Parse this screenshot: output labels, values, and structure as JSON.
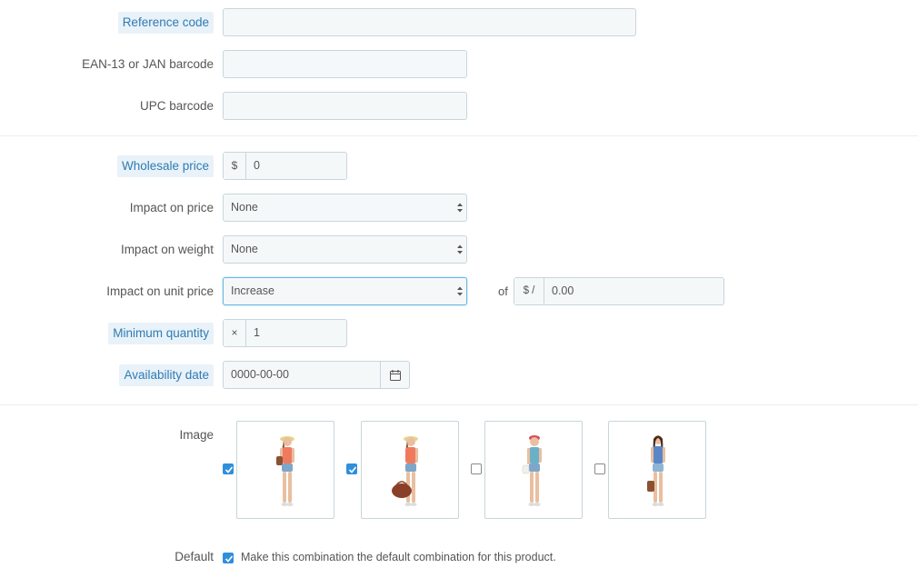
{
  "form": {
    "reference_code": {
      "label": "Reference code",
      "value": ""
    },
    "ean13": {
      "label": "EAN-13 or JAN barcode",
      "value": ""
    },
    "upc": {
      "label": "UPC barcode",
      "value": ""
    },
    "wholesale_price": {
      "label": "Wholesale price",
      "currency": "$",
      "value": "0"
    },
    "impact_price": {
      "label": "Impact on price",
      "selected": "None"
    },
    "impact_weight": {
      "label": "Impact on weight",
      "selected": "None"
    },
    "impact_unit_price": {
      "label": "Impact on unit price",
      "selected": "Increase",
      "of_label": "of",
      "unit_prefix": "$ /",
      "unit_value": "0.00"
    },
    "minimum_quantity": {
      "label": "Minimum quantity",
      "prefix": "×",
      "value": "1"
    },
    "availability_date": {
      "label": "Availability date",
      "value": "0000-00-00"
    },
    "image": {
      "label": "Image",
      "items": [
        {
          "checked": true,
          "icon": "model-photo-1"
        },
        {
          "checked": true,
          "icon": "model-photo-2"
        },
        {
          "checked": false,
          "icon": "model-photo-3"
        },
        {
          "checked": false,
          "icon": "model-photo-4"
        }
      ]
    },
    "default": {
      "label": "Default",
      "checked": true,
      "text": "Make this combination the default combination for this product."
    }
  },
  "colors": {
    "highlight_bg": "#e9f2f8",
    "highlight_text": "#2e7bb4",
    "field_bg": "#f5f8f9",
    "field_border": "#c7d6db",
    "checkbox_on": "#2f8fdd"
  }
}
